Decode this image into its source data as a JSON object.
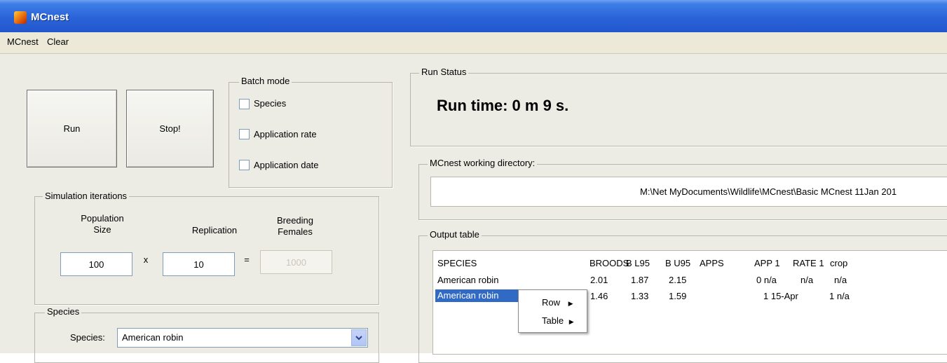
{
  "window": {
    "title": "MCnest",
    "icon": "matlab-icon"
  },
  "menu": [
    "MCnest",
    "Clear"
  ],
  "buttons": {
    "run": "Run",
    "stop": "Stop!"
  },
  "batch_mode": {
    "label": "Batch mode",
    "options": [
      {
        "label": "Species",
        "checked": false
      },
      {
        "label": "Application rate",
        "checked": false
      },
      {
        "label": "Application date",
        "checked": false
      }
    ]
  },
  "simulation": {
    "label": "Simulation iterations",
    "population_label_1": "Population",
    "population_label_2": "Size",
    "replication_label": "Replication",
    "breeding_label_1": "Breeding",
    "breeding_label_2": "Females",
    "population_value": "100",
    "times_symbol": "x",
    "replication_value": "10",
    "equals_symbol": "=",
    "breeding_value": "1000"
  },
  "species_group": {
    "label": "Species",
    "field_label": "Species:",
    "selected": "American robin"
  },
  "run_status": {
    "label": "Run Status",
    "text": "Run time: 0 m 9 s."
  },
  "working_dir": {
    "label": "MCnest working directory:",
    "path": "M:\\Net MyDocuments\\Wildlife\\MCnest\\Basic MCnest 11Jan 201"
  },
  "output_table": {
    "label": "Output table",
    "columns": [
      "SPECIES",
      "BROODS",
      "B L95",
      "B U95",
      "APPS",
      "APP 1",
      "RATE 1",
      "crop"
    ],
    "rows": [
      [
        "American robin",
        "2.01",
        "1.87",
        "2.15",
        "",
        "0 n/a",
        "n/a",
        "n/a"
      ],
      [
        "American robin",
        "1.46",
        "1.33",
        "1.59",
        "",
        "1 15-Apr",
        "",
        "1 n/a"
      ]
    ]
  },
  "context_menu": [
    "Row",
    "Table"
  ]
}
